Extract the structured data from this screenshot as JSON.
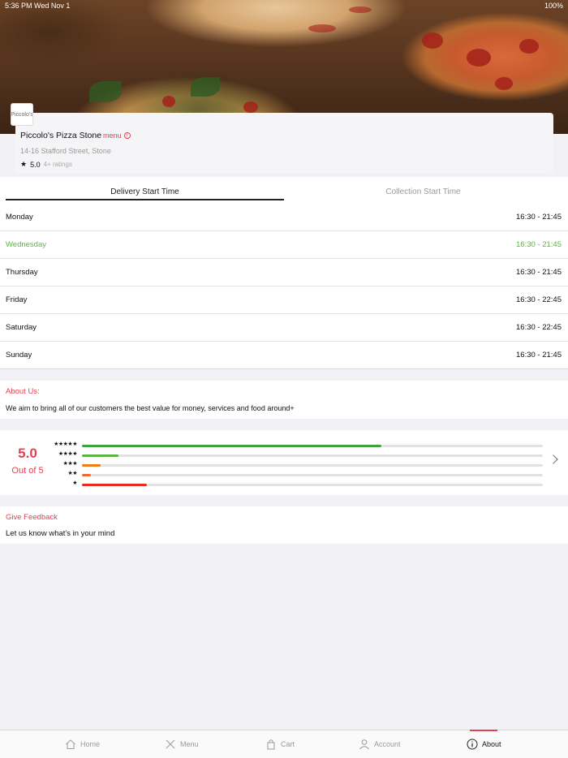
{
  "status_bar": {
    "time": "5:36 PM   Wed Nov 1",
    "battery": "100%"
  },
  "restaurant": {
    "logo_text": "Piccolo's",
    "name": "Piccolo's Pizza Stone",
    "menu_label": "menu",
    "address": "14-16 Stafford Street, Stone",
    "rating": "5.0",
    "rating_count": "4+ ratings"
  },
  "tabs": [
    {
      "label": "Delivery Start Time",
      "active": true
    },
    {
      "label": "Collection Start Time",
      "active": false
    }
  ],
  "hours": [
    {
      "day": "Monday",
      "range": "16:30 - 21:45",
      "today": false
    },
    {
      "day": "Wednesday",
      "range": "16:30 - 21:45",
      "today": true
    },
    {
      "day": "Thursday",
      "range": "16:30 - 21:45",
      "today": false
    },
    {
      "day": "Friday",
      "range": "16:30 - 22:45",
      "today": false
    },
    {
      "day": "Saturday",
      "range": "16:30 - 22:45",
      "today": false
    },
    {
      "day": "Sunday",
      "range": "16:30 - 21:45",
      "today": false
    }
  ],
  "about": {
    "title": "About Us:",
    "text": "We aim to bring all of our customers the best value for money, services and food around+"
  },
  "ratings": {
    "score": "5.0",
    "out_of": "Out of 5",
    "bars": [
      {
        "stars": "★★★★★",
        "fraction": 0.65,
        "color": "#3ea33b"
      },
      {
        "stars": "★★★★",
        "fraction": 0.08,
        "color": "#5cb541"
      },
      {
        "stars": "★★★",
        "fraction": 0.04,
        "color": "#f07d1a"
      },
      {
        "stars": "★★",
        "fraction": 0.02,
        "color": "#ee6a2a"
      },
      {
        "stars": "★",
        "fraction": 0.14,
        "color": "#e62e1f"
      }
    ]
  },
  "feedback": {
    "title": "Give Feedback",
    "text": "Let us know what's in your mind"
  },
  "nav": [
    {
      "label": "Home",
      "icon": "home-icon"
    },
    {
      "label": "Menu",
      "icon": "cutlery-icon"
    },
    {
      "label": "Cart",
      "icon": "bag-icon"
    },
    {
      "label": "Account",
      "icon": "user-icon"
    },
    {
      "label": "About",
      "icon": "info-icon",
      "active": true
    }
  ],
  "colors": {
    "accent": "#e54050",
    "today": "#5cb541"
  }
}
